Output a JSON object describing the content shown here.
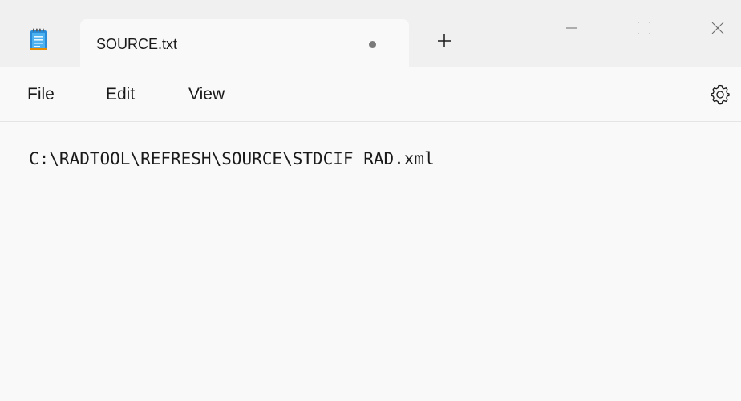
{
  "window": {
    "app_icon": "notepad-icon",
    "tab": {
      "title": "SOURCE.txt",
      "unsaved_indicator": "dot-icon"
    },
    "new_tab_icon": "plus-icon",
    "controls": [
      "minimize-icon",
      "maximize-icon",
      "close-icon"
    ]
  },
  "menu": {
    "file": "File",
    "edit": "Edit",
    "view": "View",
    "settings_icon": "gear-icon"
  },
  "editor": {
    "content": "C:\\RADTOOL\\REFRESH\\SOURCE\\STDCIF_RAD.xml"
  },
  "colors": {
    "titlebar_bg": "#f0f0f0",
    "content_bg": "#f9f9f9",
    "notepad_accent": "#2a8cd8"
  }
}
